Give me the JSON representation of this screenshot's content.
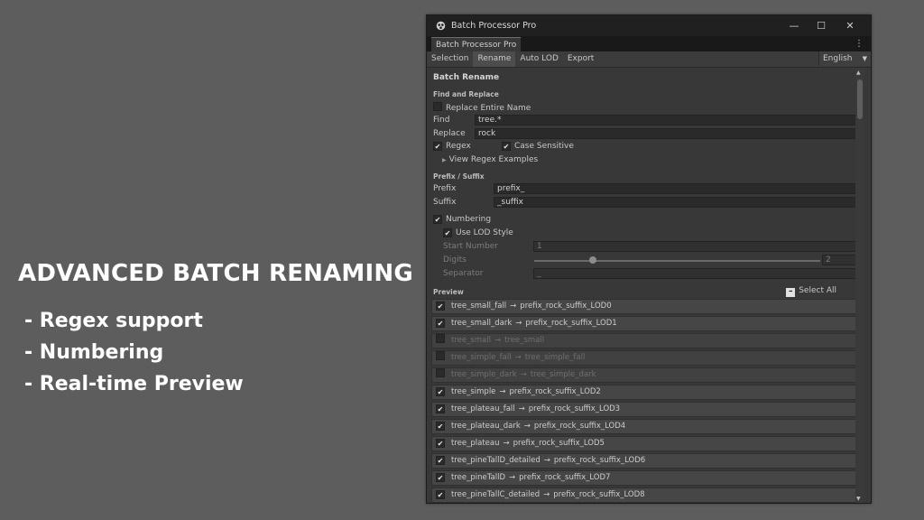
{
  "promo": {
    "title": "ADVANCED BATCH RENAMING",
    "bullets": [
      "- Regex support",
      "- Numbering",
      "- Real-time Preview"
    ]
  },
  "window": {
    "title": "Batch Processor Pro",
    "controls": {
      "minimize": "—",
      "maximize": "☐",
      "close": "✕"
    }
  },
  "doc_tab": {
    "label": "Batch Processor Pro",
    "menu_icon": "⋮"
  },
  "toolbar": {
    "tabs": [
      "Selection",
      "Rename",
      "Auto LOD",
      "Export"
    ],
    "active_tab": "Rename",
    "language": "English"
  },
  "rename": {
    "section_title": "Batch Rename",
    "find_replace": {
      "heading": "Find and Replace",
      "replace_entire_name": {
        "label": "Replace Entire Name",
        "checked": false
      },
      "find_label": "Find",
      "find_value": "tree.*",
      "replace_label": "Replace",
      "replace_value": "rock",
      "regex": {
        "label": "Regex",
        "checked": true
      },
      "case_sensitive": {
        "label": "Case Sensitive",
        "checked": true
      },
      "regex_examples": "View Regex Examples"
    },
    "prefix_suffix": {
      "heading": "Prefix / Suffix",
      "prefix_label": "Prefix",
      "prefix_value": "prefix_",
      "suffix_label": "Suffix",
      "suffix_value": "_suffix"
    },
    "numbering": {
      "label": "Numbering",
      "checked": true,
      "use_lod_style": {
        "label": "Use LOD Style",
        "checked": true
      },
      "start_number_label": "Start Number",
      "start_number_value": "1",
      "digits_label": "Digits",
      "digits_value": "2",
      "separator_label": "Separator",
      "separator_value": "_"
    },
    "preview": {
      "heading": "Preview",
      "select_all": "Select All",
      "items": [
        {
          "from": "tree_small_fall",
          "to": "prefix_rock_suffix_LOD0",
          "checked": true
        },
        {
          "from": "tree_small_dark",
          "to": "prefix_rock_suffix_LOD1",
          "checked": true
        },
        {
          "from": "tree_small",
          "to": "tree_small",
          "checked": false
        },
        {
          "from": "tree_simple_fall",
          "to": "tree_simple_fall",
          "checked": false
        },
        {
          "from": "tree_simple_dark",
          "to": "tree_simple_dark",
          "checked": false
        },
        {
          "from": "tree_simple",
          "to": "prefix_rock_suffix_LOD2",
          "checked": true
        },
        {
          "from": "tree_plateau_fall",
          "to": "prefix_rock_suffix_LOD3",
          "checked": true
        },
        {
          "from": "tree_plateau_dark",
          "to": "prefix_rock_suffix_LOD4",
          "checked": true
        },
        {
          "from": "tree_plateau",
          "to": "prefix_rock_suffix_LOD5",
          "checked": true
        },
        {
          "from": "tree_pineTallD_detailed",
          "to": "prefix_rock_suffix_LOD6",
          "checked": true
        },
        {
          "from": "tree_pineTallD",
          "to": "prefix_rock_suffix_LOD7",
          "checked": true
        },
        {
          "from": "tree_pineTallC_detailed",
          "to": "prefix_rock_suffix_LOD8",
          "checked": true
        }
      ]
    }
  },
  "icons": {
    "check": "✔",
    "arrow": "→",
    "triangle_right": "▶",
    "triangle_down": "▼",
    "triangle_up": "▲"
  },
  "colors": {
    "background": "#5d5d5d",
    "window": "#383838",
    "field": "#2a2a2a",
    "accent": "#3a79bb"
  }
}
